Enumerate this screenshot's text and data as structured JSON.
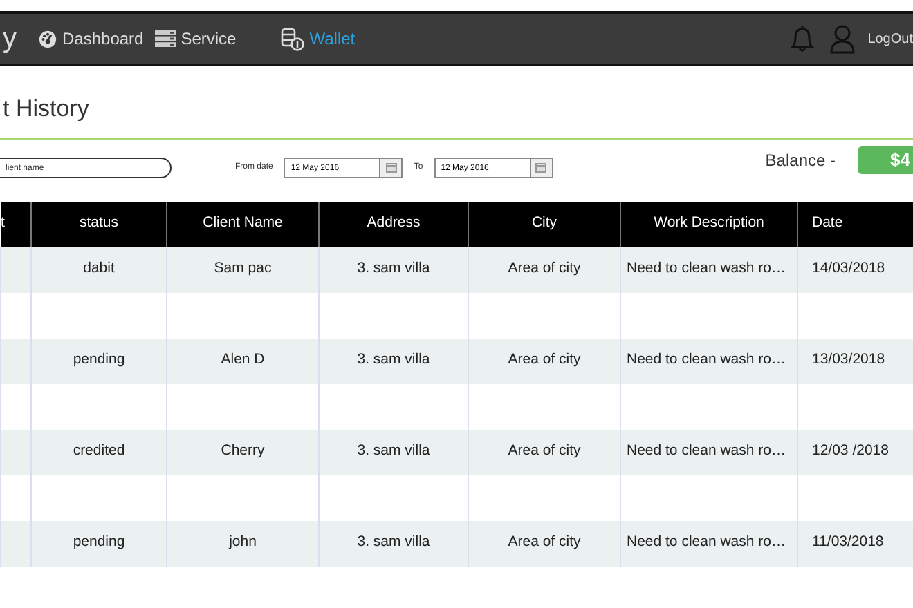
{
  "navbar": {
    "brand": "y",
    "items": [
      {
        "label": "Dashboard",
        "selected": false
      },
      {
        "label": "Service",
        "selected": false
      },
      {
        "label": "Wallet",
        "selected": true
      }
    ],
    "logout": "LogOut"
  },
  "page_title": "t  History",
  "filters": {
    "client": {
      "placeholder": "lient name"
    },
    "from_label": "From date",
    "from_value": "12 May 2016",
    "to_label": "To",
    "to_value": "12 May 2016"
  },
  "balance": {
    "label": "Balance -",
    "value": "$4"
  },
  "table": {
    "columns": [
      "t",
      "status",
      "Client Name",
      "Address",
      "City",
      "Work Description",
      "Date"
    ],
    "rows": [
      {
        "kind": "data",
        "cells": [
          "dabit",
          "Sam pac",
          "3. sam villa",
          "Area of city",
          "Need to clean wash ro…",
          "14/03/2018"
        ]
      },
      {
        "kind": "spacer"
      },
      {
        "kind": "data",
        "cells": [
          "pending",
          "Alen D",
          "3. sam villa",
          "Area of city",
          "Need to clean wash ro…",
          "13/03/2018"
        ]
      },
      {
        "kind": "spacer"
      },
      {
        "kind": "data",
        "cells": [
          "credited",
          "Cherry",
          "3. sam villa",
          "Area of city",
          "Need to clean wash ro…",
          "12/03 /2018"
        ]
      },
      {
        "kind": "spacer"
      },
      {
        "kind": "data",
        "cells": [
          "pending",
          "john",
          "3. sam villa",
          "Area of city",
          "Need to clean wash ro…",
          "11/03/2018"
        ]
      }
    ]
  }
}
